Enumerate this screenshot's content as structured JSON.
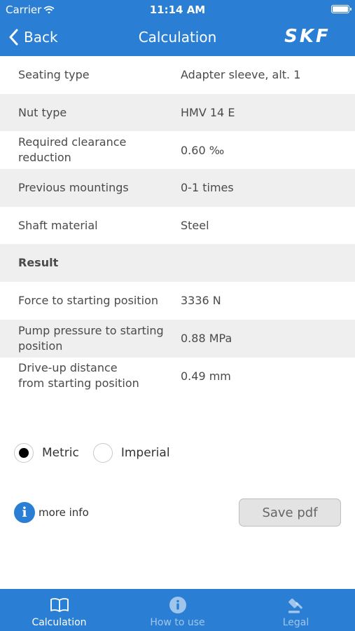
{
  "status_bar": {
    "carrier": "Carrier",
    "time": "11:14 AM"
  },
  "nav": {
    "back_label": "Back",
    "title": "Calculation",
    "logo_text": "SKF"
  },
  "rows": [
    {
      "label": "Seating type",
      "value": "Adapter sleeve, alt. 1"
    },
    {
      "label": "Nut type",
      "value": "HMV 14 E"
    },
    {
      "label": "Required clearance reduction",
      "value": "0.60 ‰"
    },
    {
      "label": "Previous mountings",
      "value": "0-1 times"
    },
    {
      "label": "Shaft material",
      "value": "Steel"
    },
    {
      "label": "Result",
      "value": ""
    },
    {
      "label": "Force to starting position",
      "value": "3336 N"
    },
    {
      "label": "Pump pressure to starting position",
      "value": "0.88 MPa"
    },
    {
      "label": "Drive-up distance\nfrom starting position",
      "value": "0.49 mm"
    }
  ],
  "units": {
    "metric": "Metric",
    "imperial": "Imperial",
    "selected": "Metric"
  },
  "more_info": {
    "label": "more info",
    "icon": "info-icon"
  },
  "save_pdf": {
    "label": "Save pdf"
  },
  "tabs": [
    {
      "label": "Calculation",
      "icon": "book-icon",
      "active": true
    },
    {
      "label": "How to use",
      "icon": "info-icon",
      "active": false
    },
    {
      "label": "Legal",
      "icon": "gavel-icon",
      "active": false
    }
  ],
  "colors": {
    "brand_blue": "#2a7fd4",
    "row_alt": "#efefef",
    "button_bg": "#e3e3e3"
  }
}
